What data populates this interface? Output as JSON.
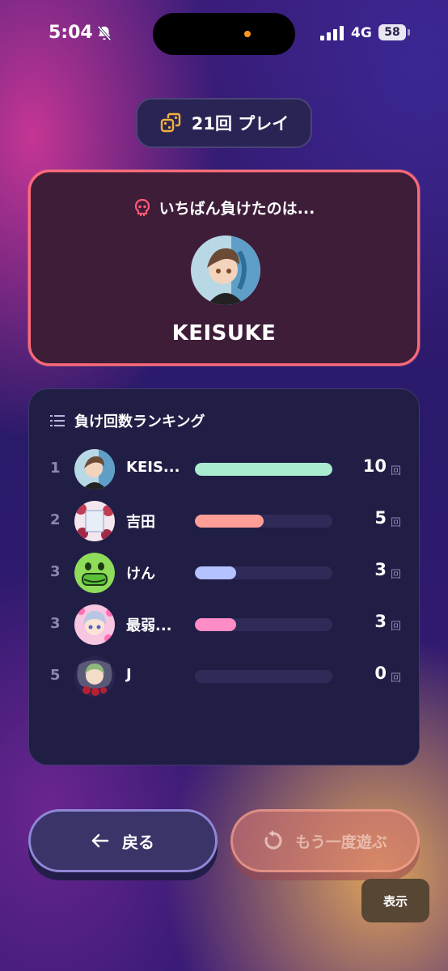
{
  "status_bar": {
    "time": "5:04",
    "network": "4G",
    "battery": "58",
    "island_dot_color": "#ff9a1f"
  },
  "play": {
    "label": "21回 プレイ",
    "icon": "dice-icon"
  },
  "loser": {
    "heading": "いちばん負けたのは...",
    "icon": "skull-icon",
    "name": "KEISUKE",
    "border_color": "#ff6a7a"
  },
  "ranking": {
    "heading": "負け回数ランキング",
    "icon": "list-icon",
    "rows": [
      {
        "rank": "1",
        "name": "KEIS...",
        "count": "10",
        "unit": "回",
        "fraction": 1.0,
        "color": "#a9ecd0"
      },
      {
        "rank": "2",
        "name": "吉田",
        "count": "5",
        "unit": "回",
        "fraction": 0.5,
        "color": "#ff9e97"
      },
      {
        "rank": "3",
        "name": "けん",
        "count": "3",
        "unit": "回",
        "fraction": 0.3,
        "color": "#b4c2ff"
      },
      {
        "rank": "3",
        "name": "最弱...",
        "count": "3",
        "unit": "回",
        "fraction": 0.3,
        "color": "#ff8cc7"
      },
      {
        "rank": "5",
        "name": "J",
        "count": "0",
        "unit": "回",
        "fraction": 0.0,
        "color": "#7f79b8"
      }
    ]
  },
  "buttons": {
    "back": "戻る",
    "play_again": "もう一度遊ぶ",
    "show": "表示"
  }
}
